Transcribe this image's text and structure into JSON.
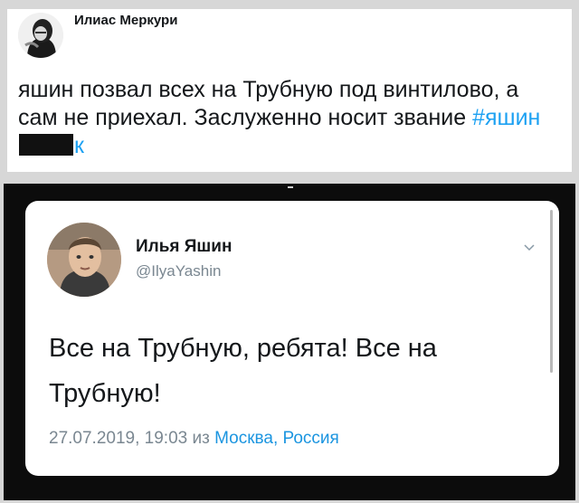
{
  "top_tweet": {
    "author_name": "Илиас Меркури",
    "text": "яшин позвал всех на Трубную под винтилово, а сам не приехал. Заслуженно носит звание",
    "hashtag_start": "#яшин",
    "hashtag_end": "к"
  },
  "embedded_tweet": {
    "author_name": "Илья Яшин",
    "handle": "@IlyaYashin",
    "text": "Все на Трубную, ребята! Все на Трубную!",
    "timestamp": "27.07.2019, 19:03",
    "from_word": "из",
    "location": "Москва, Россия"
  },
  "icons": {
    "top_avatar": "avatar-portrait-bw",
    "inner_avatar": "avatar-portrait-photo",
    "chevron": "chevron-down-icon"
  },
  "colors": {
    "link": "#1da1f2",
    "muted": "#7a8791",
    "frame": "#0c0c0c",
    "background": "#d7d7d7"
  }
}
